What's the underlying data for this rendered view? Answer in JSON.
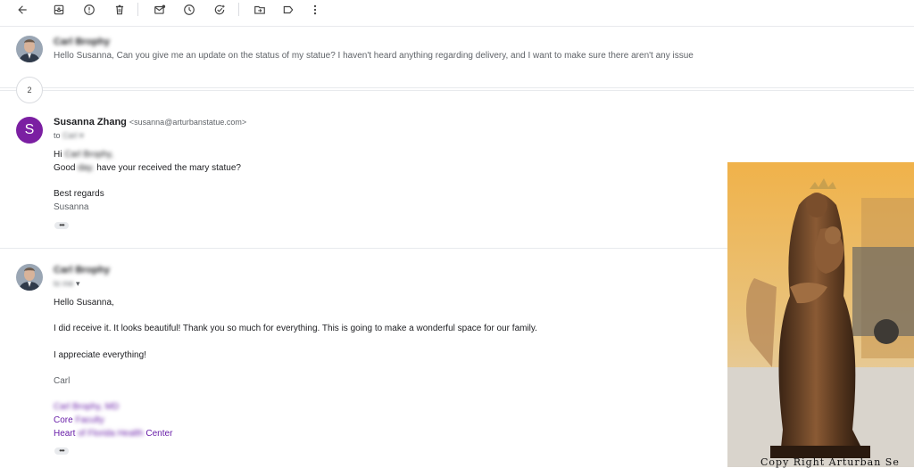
{
  "toolbar": {
    "icons": [
      "back-arrow-icon",
      "archive-icon",
      "report-spam-icon",
      "delete-icon",
      "mark-unread-icon",
      "snooze-icon",
      "add-to-tasks-icon",
      "move-to-icon",
      "label-icon",
      "more-vert-icon"
    ]
  },
  "thread": {
    "collapsed_message": {
      "sender": "Carl Brophy",
      "snippet": "Hello Susanna, Can you give me an update on the status of my statue? I haven't heard anything regarding delivery, and I want to make sure there aren't any issue"
    },
    "hidden_count": "2",
    "message_1": {
      "avatar_letter": "S",
      "sender": "Susanna Zhang",
      "email": "<susanna@arturbanstatue.com>",
      "to_label": "to",
      "to_name": "Carl",
      "greeting_hi": "Hi",
      "greeting_name": "Carl Brophy,",
      "line_good": "Good",
      "line_day": "day.",
      "line_rest": "have your received the mary statue?",
      "closing": "Best regards",
      "signature": "Susanna"
    },
    "message_2": {
      "sender": "Carl Brophy",
      "to_label": "to me",
      "greeting": "Hello Susanna,",
      "body_1": "I did receive it. It looks beautiful! Thank you so much for everything. This is going to make a wonderful space for our family.",
      "body_2": "I appreciate everything!",
      "signoff": "Carl",
      "sig_line_1": "Carl Brophy, MD",
      "sig_line_2_a": "Core",
      "sig_line_2_b": "Faculty",
      "sig_line_3_a": "Heart",
      "sig_line_3_b": "of Florida Health",
      "sig_line_3_c": "Center"
    },
    "attachment": {
      "watermark": "Copy Right Arturban Se"
    }
  },
  "colors": {
    "avatar_purple": "#7b1fa2",
    "signature_purple": "#681da8",
    "divider": "#e8eaed"
  }
}
